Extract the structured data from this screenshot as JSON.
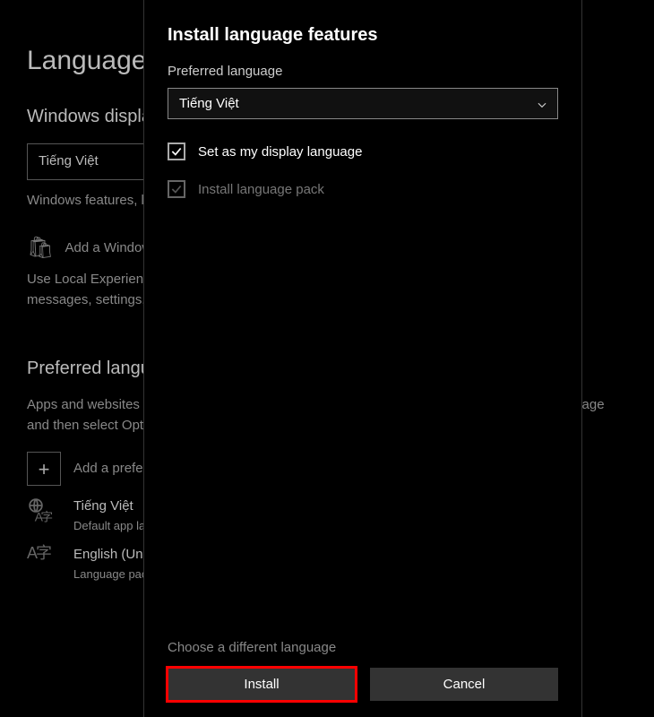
{
  "background": {
    "title": "Language",
    "display_heading": "Windows display language",
    "display_dropdown_value": "Tiếng Việt",
    "display_desc": "Windows features, like Settings and Explorer, will appear in this language.",
    "add_pack_label": "Add a Windows display language",
    "lep_desc": "Use Local Experience Packs to change the language Windows uses for navigation, menus, messages, settings, and help topics.",
    "pref_heading": "Preferred languages",
    "pref_desc": "Apps and websites will appear in the first language in the list that they support. Select a language and then select Options to configure keyboards and other features.",
    "add_pref_label": "Add a preferred language",
    "lang1_name": "Tiếng Việt",
    "lang1_sub": "Default app language, Windows display language",
    "lang2_name": "English (United States)",
    "lang2_sub": "Language pack installed"
  },
  "dialog": {
    "title": "Install language features",
    "pref_label": "Preferred language",
    "dropdown_value": "Tiếng Việt",
    "opt_display": "Set as my display language",
    "opt_pack": "Install language pack",
    "choose_link": "Choose a different language",
    "install_btn": "Install",
    "cancel_btn": "Cancel"
  }
}
